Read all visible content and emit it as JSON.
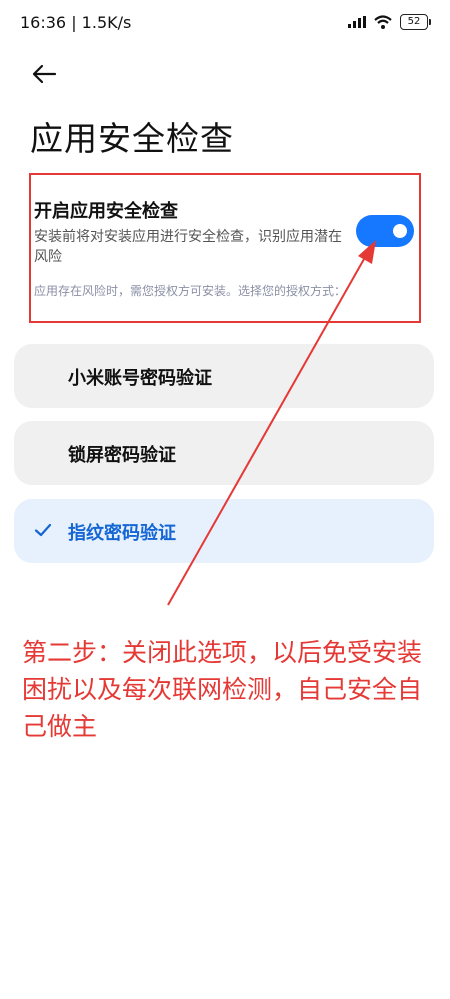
{
  "status_bar": {
    "time": "16:36 | 1.5K/s",
    "battery": "52"
  },
  "header": {
    "title": "应用安全检查"
  },
  "security_check": {
    "title": "开启应用安全检查",
    "description": "安装前将对安装应用进行安全检查，识别应用潜在风险",
    "note": "应用存在风险时，需您授权方可安装。选择您的授权方式：",
    "toggle_on": true
  },
  "auth_options": [
    {
      "label": "小米账号密码验证",
      "selected": false
    },
    {
      "label": "锁屏密码验证",
      "selected": false
    },
    {
      "label": "指纹密码验证",
      "selected": true
    }
  ],
  "annotation": {
    "text": "第二步：关闭此选项，以后免受安装困扰以及每次联网检测，自己安全自己做主",
    "color": "#e53935"
  },
  "colors": {
    "accent": "#1677ff",
    "selected_text": "#1566d4",
    "selected_bg": "#e6f1fd",
    "option_bg": "#f0f0f0"
  },
  "icons": {
    "back": "back-arrow-icon",
    "signal": "signal-icon",
    "wifi": "wifi-icon",
    "battery": "battery-icon",
    "check": "check-icon"
  }
}
